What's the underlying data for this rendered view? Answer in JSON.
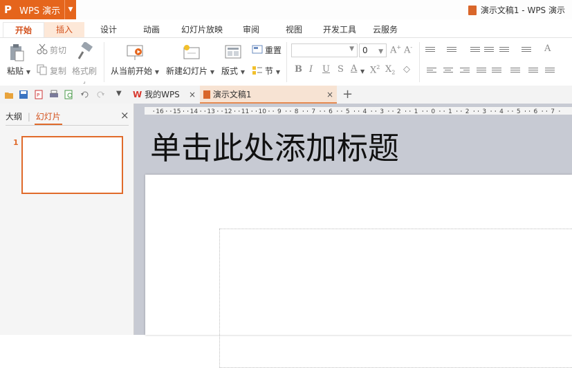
{
  "app": {
    "name": "WPS 演示",
    "logo": "P"
  },
  "window": {
    "title": "演示文稿1 - WPS 演示"
  },
  "ribbon_tabs": [
    "开始",
    "插入",
    "设计",
    "动画",
    "幻灯片放映",
    "审阅",
    "视图",
    "开发工具",
    "云服务"
  ],
  "clipboard": {
    "paste": "粘贴",
    "cut": "剪切",
    "copy": "复制",
    "format_painter": "格式刷"
  },
  "slides_group": {
    "from_current": "从当前开始",
    "new_slide": "新建幻灯片",
    "layout": "版式",
    "reset": "重置",
    "section": "节"
  },
  "font": {
    "name_value": "",
    "size_value": "0"
  },
  "doc_tabs": {
    "mywps": "我的WPS",
    "doc": "演示文稿1"
  },
  "panel": {
    "outline": "大纲",
    "divider": "|",
    "slides": "幻灯片",
    "close": "×"
  },
  "slide": {
    "number": "1",
    "title_placeholder": "单击此处添加标题"
  },
  "ruler_labels": [
    "16",
    "15",
    "14",
    "13",
    "12",
    "11",
    "10",
    "9",
    "8",
    "7",
    "6",
    "5",
    "4",
    "3",
    "2",
    "1",
    "0",
    "1",
    "2",
    "3",
    "4",
    "5",
    "6",
    "7"
  ],
  "colors": {
    "accent": "#e5651c",
    "active_tab_text": "#d3511c",
    "canvas_bg": "#c7cad3"
  }
}
